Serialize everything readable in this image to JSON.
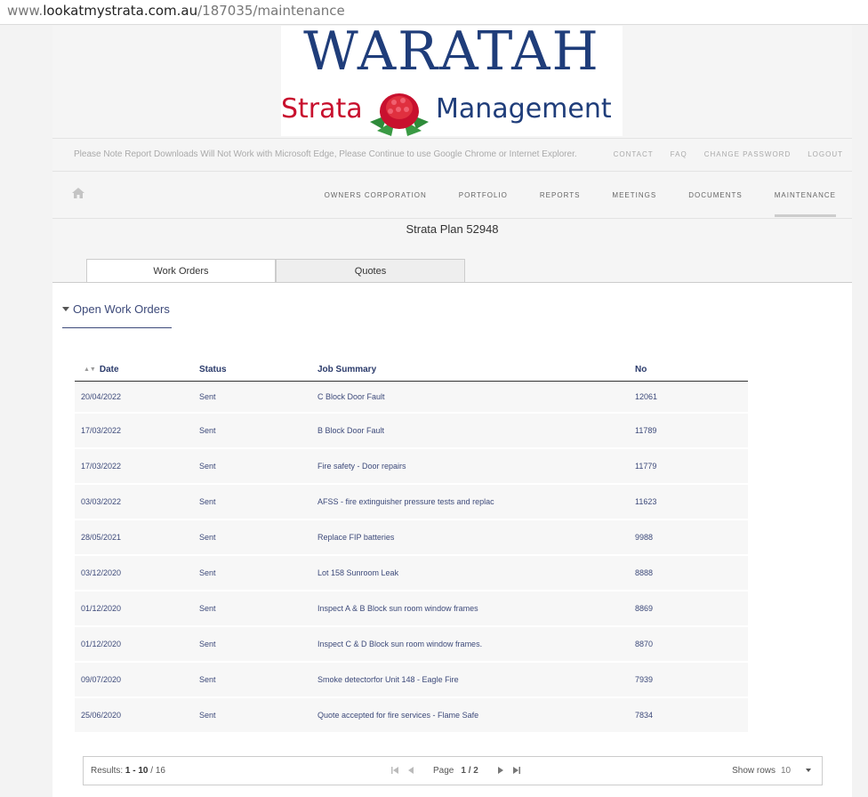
{
  "browser": {
    "url_prefix": "www.",
    "url_host": "lookatmystrata.com.au",
    "url_path": "/187035/maintenance"
  },
  "logo": {
    "line1": "WARATAH",
    "line2_left": "Strata",
    "line2_right": "Management"
  },
  "notice": "Please Note Report Downloads Will Not Work with Microsoft Edge, Please Continue to use Google Chrome or Internet Explorer.",
  "toplinks": [
    "CONTACT",
    "FAQ",
    "CHANGE PASSWORD",
    "LOGOUT"
  ],
  "nav": [
    "OWNERS CORPORATION",
    "PORTFOLIO",
    "REPORTS",
    "MEETINGS",
    "DOCUMENTS",
    "MAINTENANCE"
  ],
  "plan_title": "Strata Plan 52948",
  "tabs": [
    "Work Orders",
    "Quotes"
  ],
  "section_title": "Open Work Orders",
  "table": {
    "headers": [
      "Date",
      "Status",
      "Job Summary",
      "No"
    ],
    "rows": [
      [
        "20/04/2022",
        "Sent",
        "C Block Door Fault",
        "12061"
      ],
      [
        "17/03/2022",
        "Sent",
        "B Block Door Fault",
        "11789"
      ],
      [
        "17/03/2022",
        "Sent",
        "Fire safety - Door repairs",
        "11779"
      ],
      [
        "03/03/2022",
        "Sent",
        "AFSS - fire extinguisher pressure tests and replac",
        "11623"
      ],
      [
        "28/05/2021",
        "Sent",
        "Replace FIP batteries",
        "9988"
      ],
      [
        "03/12/2020",
        "Sent",
        "Lot 158 Sunroom Leak",
        "8888"
      ],
      [
        "01/12/2020",
        "Sent",
        "Inspect A & B Block sun room window frames",
        "8869"
      ],
      [
        "01/12/2020",
        "Sent",
        "Inspect C & D Block sun room window frames.",
        "8870"
      ],
      [
        "09/07/2020",
        "Sent",
        "Smoke detectorfor Unit 148 - Eagle Fire",
        "7939"
      ],
      [
        "25/06/2020",
        "Sent",
        "Quote accepted for fire services - Flame Safe",
        "7834"
      ]
    ]
  },
  "pager": {
    "results_label": "Results:",
    "results_range": "1 - 10",
    "results_total": "/ 16",
    "page_label": "Page",
    "page_value": "1 / 2",
    "show_rows_label": "Show rows",
    "rows_value": "10"
  }
}
